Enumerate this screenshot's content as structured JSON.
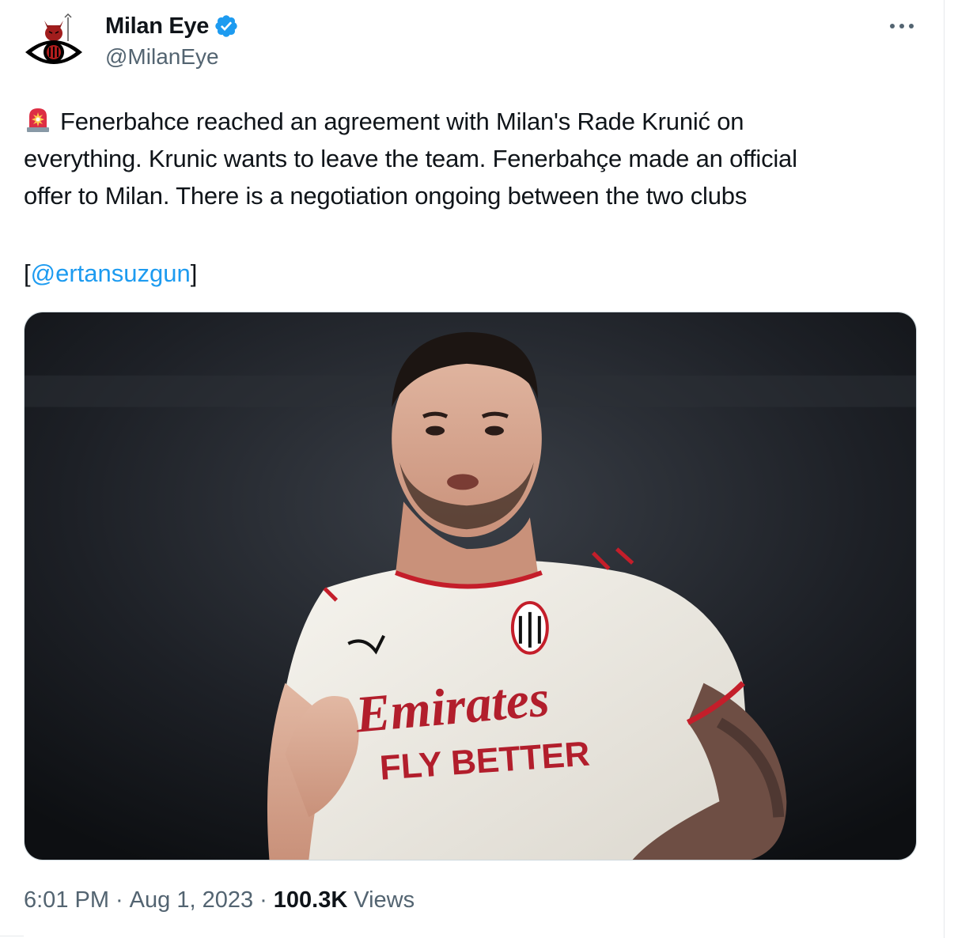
{
  "author": {
    "display_name": "Milan Eye",
    "handle": "@MilanEye",
    "verified": true,
    "avatar_icon": "devil-eye-logo-icon"
  },
  "menu": {
    "icon": "more-options-icon"
  },
  "tweet": {
    "lines": [
      "Fenerbahce reached an agreement with Milan's Rade Krunić on",
      "everything. Krunic wants to leave the team. Fenerbahçe made an official",
      "offer to Milan. There is a negotiation ongoing between the two clubs"
    ],
    "leading_emoji": "police-siren-icon",
    "credit_open": "[",
    "mention": "@ertansuzgun",
    "credit_close": "]"
  },
  "media": {
    "jersey_sponsor": "Emirates",
    "jersey_slogan": "FLY BETTER"
  },
  "footer": {
    "time": "6:01 PM",
    "separator": "·",
    "date": "Aug 1, 2023",
    "views_count": "100.3K",
    "views_label": "Views"
  },
  "colors": {
    "link": "#1d9bf0",
    "verified_badge": "#1d9bf0",
    "secondary_text": "#536471",
    "primary_text": "#0f1419"
  }
}
